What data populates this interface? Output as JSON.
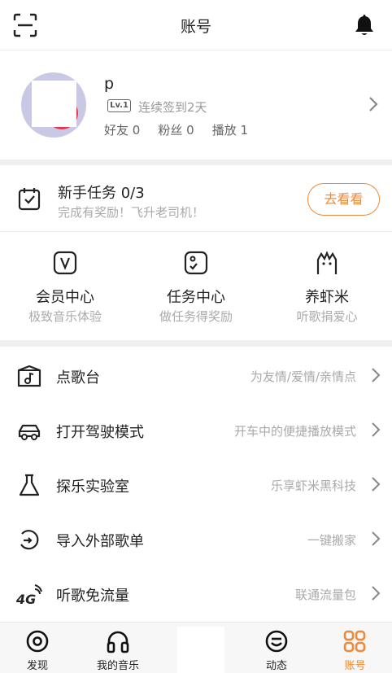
{
  "header": {
    "title": "账号",
    "icons": {
      "scan": "scan-icon",
      "notification": "bell-icon"
    }
  },
  "profile": {
    "username": "p",
    "level_badge": "Lv.1",
    "checkin_text": "连续签到2天",
    "stats": [
      {
        "label": "好友",
        "value": "0"
      },
      {
        "label": "粉丝",
        "value": "0"
      },
      {
        "label": "播放",
        "value": "1"
      }
    ]
  },
  "newbie_task": {
    "title": "新手任务 0/3",
    "subtitle": "完成有奖励！飞升老司机！",
    "button_label": "去看看",
    "icon": "calendar-check-icon"
  },
  "tiles": [
    {
      "title": "会员中心",
      "subtitle": "极致音乐体验",
      "icon": "vip-icon"
    },
    {
      "title": "任务中心",
      "subtitle": "做任务得奖励",
      "icon": "task-icon"
    },
    {
      "title": "养虾米",
      "subtitle": "听歌捐爱心",
      "icon": "shrimp-icon"
    }
  ],
  "menu": [
    {
      "label": "点歌台",
      "hint": "为友情/爱情/亲情点",
      "icon": "music-box-icon"
    },
    {
      "label": "打开驾驶模式",
      "hint": "开车中的便捷播放模式",
      "icon": "car-icon"
    },
    {
      "label": "探乐实验室",
      "hint": "乐享虾米黑科技",
      "icon": "flask-icon"
    },
    {
      "label": "导入外部歌单",
      "hint": "一键搬家",
      "icon": "import-icon"
    },
    {
      "label": "听歌免流量",
      "hint": "联通流量包",
      "icon": "4g-icon"
    }
  ],
  "tabbar": [
    {
      "label": "发现",
      "icon": "discover-icon",
      "active": false
    },
    {
      "label": "我的音乐",
      "icon": "headphones-icon",
      "active": false
    },
    {
      "label": "动态",
      "icon": "feed-icon",
      "active": false
    },
    {
      "label": "账号",
      "icon": "account-grid-icon",
      "active": true
    }
  ],
  "colors": {
    "accent": "#f08a3a",
    "text": "#222222",
    "muted": "#aaaaaa"
  }
}
